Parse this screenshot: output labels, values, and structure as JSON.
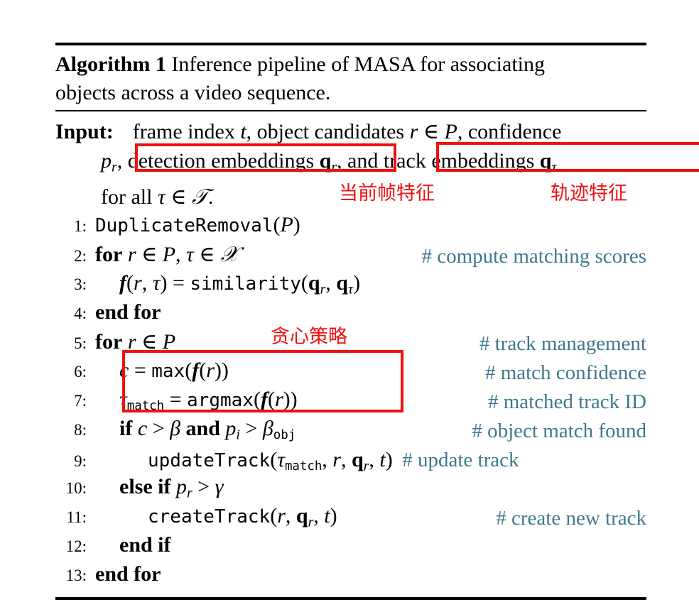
{
  "algorithm": {
    "label": "Algorithm 1",
    "caption": "Inference pipeline of MASA for associating objects across a video sequence.",
    "input_keyword": "Input:",
    "input_lines": [
      "frame index t, object candidates r ∈ P, confidence",
      "p_r, detection embeddings q_r, and track embeddings q_τ",
      "for all τ ∈ 𝒯."
    ],
    "lines": [
      {
        "number": "1:",
        "code": "DuplicateRemoval(P)",
        "comment": ""
      },
      {
        "number": "2:",
        "code": "for r ∈ P, τ ∈ 𝒯",
        "comment": "# compute matching scores"
      },
      {
        "number": "3:",
        "code": "f(r, τ) = similarity(q_r, q_τ)",
        "comment": ""
      },
      {
        "number": "4:",
        "code": "end for",
        "comment": ""
      },
      {
        "number": "5:",
        "code": "for r ∈ P",
        "comment": "# track management"
      },
      {
        "number": "6:",
        "code": "c = max(f(r))",
        "comment": "# match confidence"
      },
      {
        "number": "7:",
        "code": "τ_match = argmax(f(r))",
        "comment": "# matched track ID"
      },
      {
        "number": "8:",
        "code": "if c > β and p_i > β_obj",
        "comment": "# object match found"
      },
      {
        "number": "9:",
        "code": "updateTrack(τ_match, r, q_r, t)",
        "comment": "# update track"
      },
      {
        "number": "10:",
        "code": "else if p_r > γ",
        "comment": ""
      },
      {
        "number": "11:",
        "code": "createTrack(r, q_r, t)",
        "comment": "# create new track"
      },
      {
        "number": "12:",
        "code": "end if",
        "comment": ""
      },
      {
        "number": "13:",
        "code": "end for",
        "comment": ""
      }
    ]
  },
  "annotations": {
    "color": "#f01010",
    "comment_color": "#3d7a8c",
    "notes": [
      {
        "id": "current-frame-feature",
        "text": "当前帧特征"
      },
      {
        "id": "trajectory-feature",
        "text": "轨迹特征"
      },
      {
        "id": "greedy-strategy",
        "text": "贪心策略"
      }
    ],
    "boxes": [
      {
        "id": "detection-embeddings-box",
        "label": "detection embeddings q_r,"
      },
      {
        "id": "track-embeddings-box",
        "label": "track embeddings q_τ"
      },
      {
        "id": "greedy-selection-box",
        "label": "c = max(f(r)) / τ_match = argmax(f(r))"
      }
    ]
  },
  "comments": {
    "c2": "# compute matching scores",
    "c5": "# track management",
    "c6": "# match confidence",
    "c7": "# matched track ID",
    "c8": "# object match found",
    "c9": "# update track",
    "c11": "# create new track"
  },
  "text": {
    "caption_prefix": "Inference pipeline of MASA for associating",
    "caption_second": "objects across a video sequence.",
    "in_l1_a": "frame index",
    "in_l1_t": "t",
    "in_l1_b": ", object candidates",
    "in_l1_r": "r",
    "in_l1_in": "∈",
    "in_l1_P": "P",
    "in_l1_c": ", confidence",
    "in_l2_pr": "p",
    "in_l2_prsub": "r",
    "in_l2_comma": ",",
    "in_l2_det": "detection embeddings",
    "in_l2_qr": "q",
    "in_l2_qrsub": "r",
    "in_l2_qrcomma": ",",
    "in_l2_and": "and",
    "in_l2_trk": "track embeddings",
    "in_l2_qt": "q",
    "in_l2_qtsub": "τ",
    "in_l3_forall": "for all",
    "in_l3_tau": "τ",
    "in_l3_in": "∈",
    "in_l3_T": "𝒯",
    "in_l3_dot": ".",
    "kw_for": "for",
    "kw_endfor": "end for",
    "kw_if": "if",
    "kw_elseif": "else if",
    "kw_endif": "end if",
    "kw_and": "and",
    "fn_dup": "DuplicateRemoval",
    "fn_sim": "similarity",
    "fn_max": "max",
    "fn_argmax": "argmax",
    "fn_update": "updateTrack",
    "fn_create": "createTrack"
  }
}
